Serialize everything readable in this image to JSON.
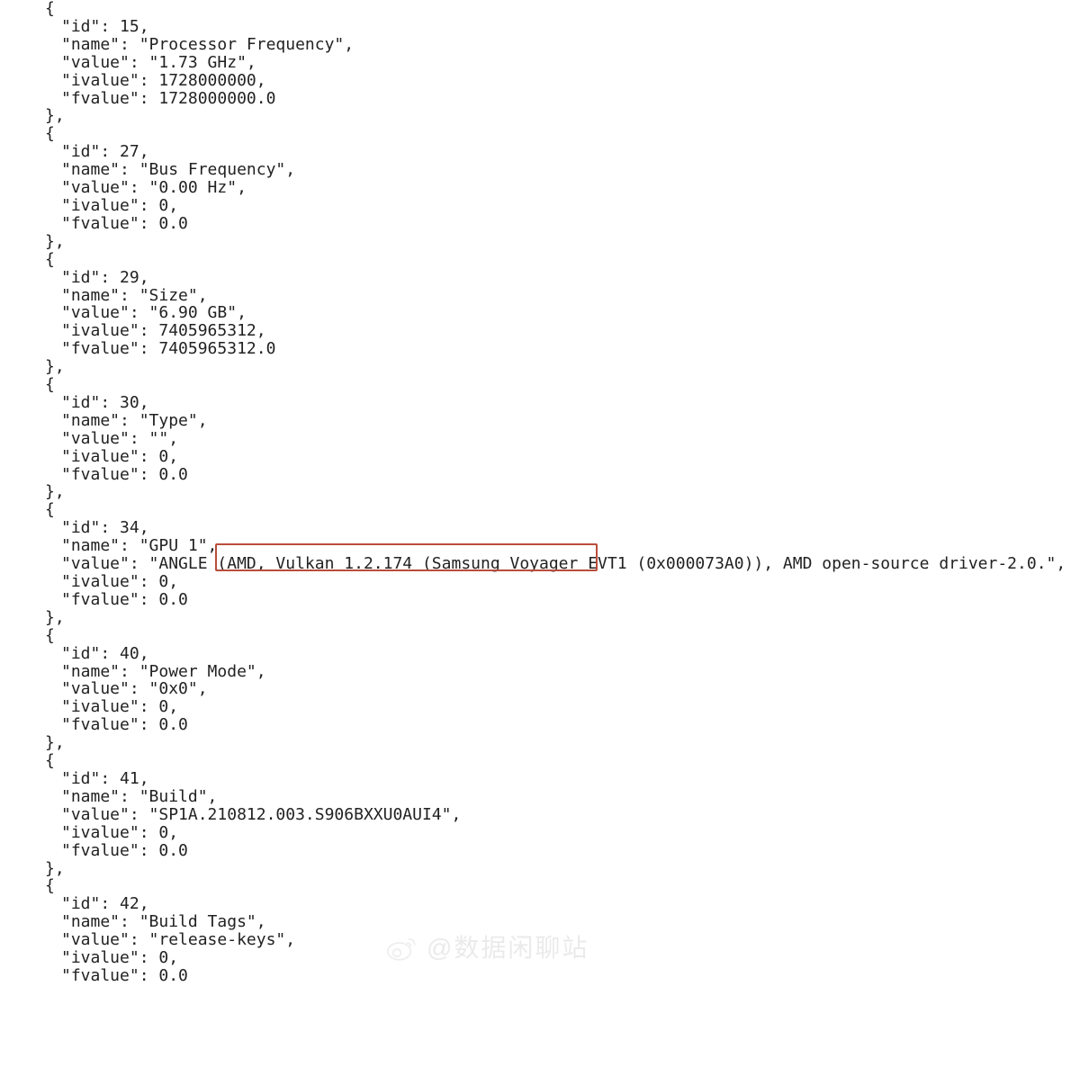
{
  "entries": [
    {
      "id": 15,
      "name": "Processor Frequency",
      "value": "1.73 GHz",
      "ivalue": "1728000000",
      "fvalue": "1728000000.0"
    },
    {
      "id": 27,
      "name": "Bus Frequency",
      "value": "0.00 Hz",
      "ivalue": "0",
      "fvalue": "0.0"
    },
    {
      "id": 29,
      "name": "Size",
      "value": "6.90 GB",
      "ivalue": "7405965312",
      "fvalue": "7405965312.0"
    },
    {
      "id": 30,
      "name": "Type",
      "value": "",
      "ivalue": "0",
      "fvalue": "0.0"
    },
    {
      "id": 34,
      "name": "GPU 1",
      "value": "ANGLE (AMD, Vulkan 1.2.174 (Samsung Voyager EVT1 (0x000073A0)), AMD open-source driver-2.0.",
      "ivalue": "0",
      "fvalue": "0.0"
    },
    {
      "id": 40,
      "name": "Power Mode",
      "value": "0x0",
      "ivalue": "0",
      "fvalue": "0.0"
    },
    {
      "id": 41,
      "name": "Build",
      "value": "SP1A.210812.003.S906BXXU0AUI4",
      "ivalue": "0",
      "fvalue": "0.0"
    },
    {
      "id": 42,
      "name": "Build Tags",
      "value": "release-keys",
      "ivalue": "0",
      "fvalue": "0.0"
    }
  ],
  "watermark": "@数据闲聊站"
}
